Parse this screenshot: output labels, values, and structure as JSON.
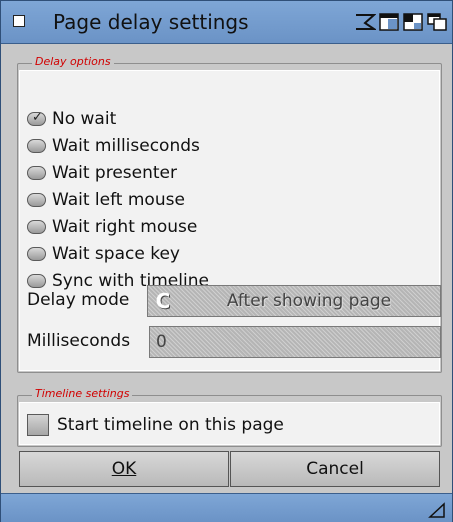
{
  "window": {
    "title": "Page delay settings",
    "accent_color": "#6b93c6",
    "gadget_icons": [
      "iconify-icon",
      "zoom-icon",
      "depth-icon",
      "snapshot-icon"
    ]
  },
  "delay_options": {
    "legend": "Delay options",
    "legend_color": "#d10000",
    "options": [
      {
        "label": "No wait",
        "checked": true
      },
      {
        "label": "Wait milliseconds",
        "checked": false
      },
      {
        "label": "Wait presenter",
        "checked": false
      },
      {
        "label": "Wait left mouse",
        "checked": false
      },
      {
        "label": "Wait right mouse",
        "checked": false
      },
      {
        "label": "Wait space key",
        "checked": false
      },
      {
        "label": "Sync with timeline",
        "checked": false
      }
    ],
    "delay_mode_label": "Delay mode",
    "delay_mode_value": "After showing page",
    "milliseconds_label": "Milliseconds",
    "milliseconds_value": "0"
  },
  "timeline_settings": {
    "legend": "Timeline settings",
    "checkbox_label": "Start timeline on this page",
    "checked": false
  },
  "buttons": {
    "ok": "OK",
    "cancel": "Cancel"
  }
}
